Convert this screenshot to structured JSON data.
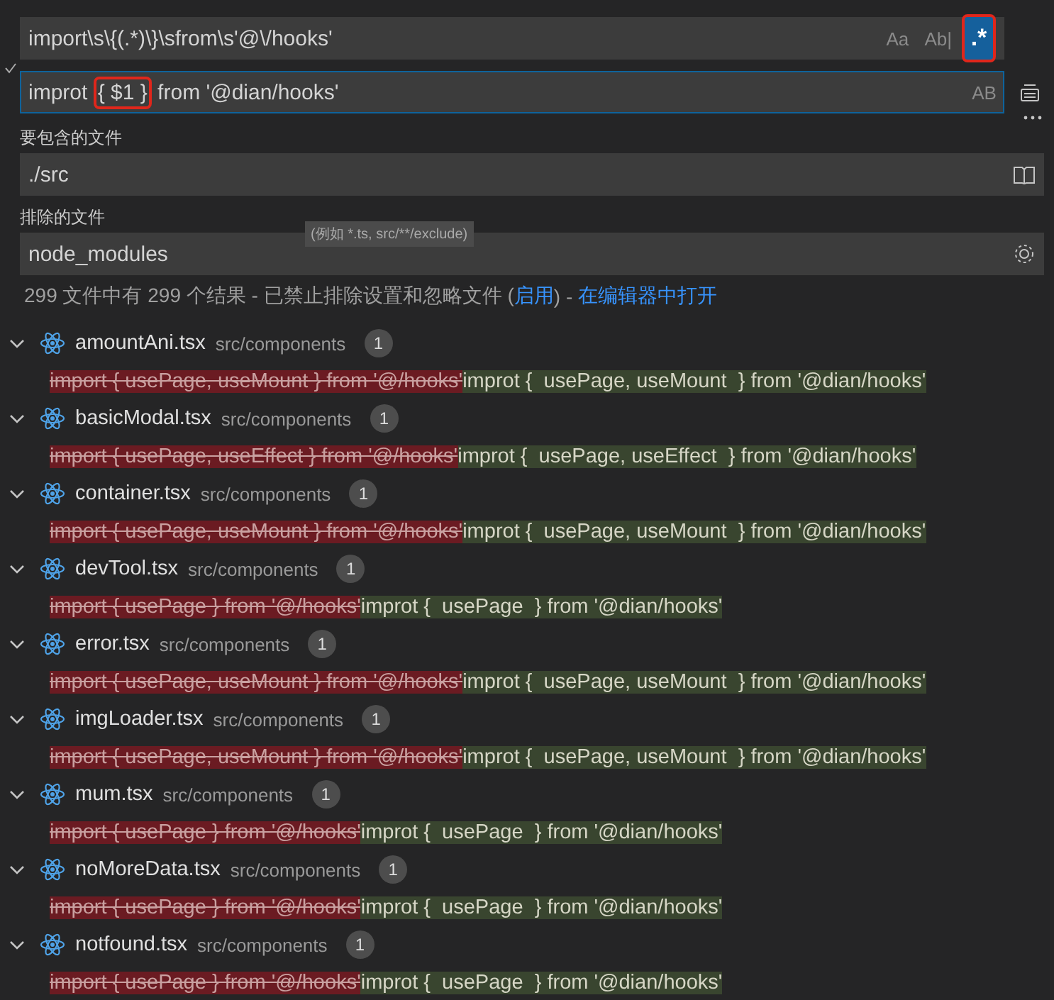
{
  "search": {
    "value": "import\\s\\{(.*)\\}\\sfrom\\s'@\\/hooks'",
    "toggles": [
      {
        "label": "Aa",
        "on": false
      },
      {
        "label": "Ab|",
        "on": false
      },
      {
        "label": ".*",
        "on": true
      }
    ]
  },
  "replace": {
    "segments": [
      {
        "text": "improt ",
        "annotated": false
      },
      {
        "text": "{ $1 }",
        "annotated": true
      },
      {
        "text": " from '@dian/hooks'",
        "annotated": false
      }
    ],
    "preserve_case": "AB"
  },
  "include": {
    "label": "要包含的文件",
    "value": "./src"
  },
  "exclude": {
    "label": "排除的文件",
    "value": "node_modules",
    "tooltip": "(例如 *.ts, src/**/exclude)"
  },
  "summary": {
    "text": "299 文件中有 299 个结果 - 已禁止排除设置和忽略文件 (",
    "link1": "启用",
    "mid": ") - ",
    "link2": "在编辑器中打开"
  },
  "results": [
    {
      "file": "amountAni.tsx",
      "path": "src/components",
      "count": "1",
      "expanded": true,
      "removed": "import { usePage, useMount } from '@/hooks'",
      "added": "improt {  usePage, useMount  } from '@dian/hooks'"
    },
    {
      "file": "basicModal.tsx",
      "path": "src/components",
      "count": "1",
      "expanded": true,
      "removed": "import { usePage, useEffect } from '@/hooks'",
      "added": "improt {  usePage, useEffect  } from '@dian/hooks'"
    },
    {
      "file": "container.tsx",
      "path": "src/components",
      "count": "1",
      "expanded": true,
      "removed": "import { usePage, useMount } from '@/hooks'",
      "added": "improt {  usePage, useMount  } from '@dian/hooks'"
    },
    {
      "file": "devTool.tsx",
      "path": "src/components",
      "count": "1",
      "expanded": true,
      "removed": "import { usePage } from '@/hooks'",
      "added": "improt {  usePage  } from '@dian/hooks'"
    },
    {
      "file": "error.tsx",
      "path": "src/components",
      "count": "1",
      "expanded": true,
      "removed": "import { usePage, useMount } from '@/hooks'",
      "added": "improt {  usePage, useMount  } from '@dian/hooks'"
    },
    {
      "file": "imgLoader.tsx",
      "path": "src/components",
      "count": "1",
      "expanded": true,
      "removed": "import { usePage, useMount } from '@/hooks'",
      "added": "improt {  usePage, useMount  } from '@dian/hooks'"
    },
    {
      "file": "mum.tsx",
      "path": "src/components",
      "count": "1",
      "expanded": true,
      "removed": "import { usePage } from '@/hooks'",
      "added": "improt {  usePage  } from '@dian/hooks'"
    },
    {
      "file": "noMoreData.tsx",
      "path": "src/components",
      "count": "1",
      "expanded": true,
      "removed": "import { usePage } from '@/hooks'",
      "added": "improt {  usePage  } from '@dian/hooks'"
    },
    {
      "file": "notfound.tsx",
      "path": "src/components",
      "count": "1",
      "expanded": true,
      "removed": "import { usePage } from '@/hooks'",
      "added": "improt {  usePage  } from '@dian/hooks'"
    }
  ]
}
